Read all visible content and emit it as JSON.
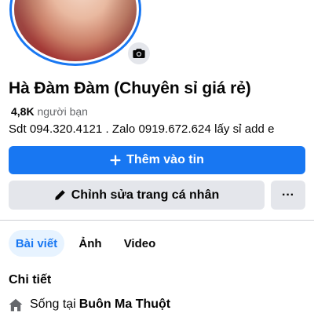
{
  "profile": {
    "name": "Hà Đàm Đàm (Chuyên sỉ giá rẻ)",
    "friends_count": "4,8K",
    "friends_label": "người bạn",
    "bio": "Sdt 094.320.4121 . Zalo 0919.672.624 lấy sỉ add e"
  },
  "actions": {
    "add_story_label": "Thêm vào tin",
    "edit_profile_label": "Chỉnh sửa trang cá nhân",
    "more_label": "···"
  },
  "tabs": [
    {
      "label": "Bài viết",
      "active": true
    },
    {
      "label": "Ảnh",
      "active": false
    },
    {
      "label": "Video",
      "active": false
    }
  ],
  "details": {
    "title": "Chi tiết",
    "lives_in_prefix": "Sống tại",
    "city": "Buôn Ma Thuột"
  },
  "icons": {
    "camera": "camera-icon",
    "plus": "plus-icon",
    "pencil": "pencil-icon",
    "home": "home-icon"
  },
  "colors": {
    "accent": "#1877f2",
    "secondary_button": "#e4e6eb",
    "active_tab_bg": "#e7f3ff",
    "muted_text": "#65676b"
  }
}
